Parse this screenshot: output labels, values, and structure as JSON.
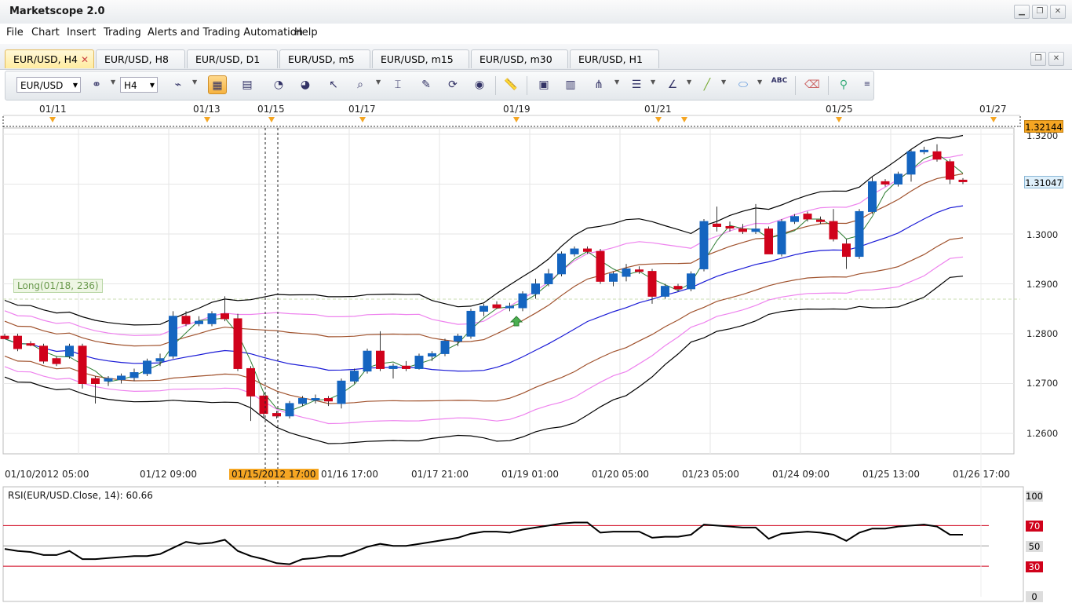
{
  "app": {
    "title": "Marketscope 2.0"
  },
  "window_controls": {
    "minimize": "▁",
    "restore": "❐",
    "close": "✕"
  },
  "menu": [
    "File",
    "Chart",
    "Insert",
    "Trading",
    "Alerts and Trading Automation",
    "Help"
  ],
  "tabs": [
    {
      "label": "EUR/USD, H4",
      "active": true,
      "close": "✕"
    },
    {
      "label": "EUR/USD, H8"
    },
    {
      "label": "EUR/USD, D1"
    },
    {
      "label": "EUR/USD, m5"
    },
    {
      "label": "EUR/USD, m15"
    },
    {
      "label": "EUR/USD, m30"
    },
    {
      "label": "EUR/USD, H1"
    }
  ],
  "toolbar": {
    "instrument": "EUR/USD",
    "timeframe": "H4",
    "icons": [
      "chart-type-icon",
      "candles-icon",
      "bars-icon",
      "add-indicator-icon",
      "remove-indicator-icon",
      "cursor-icon",
      "zoom-icon",
      "crosshair-icon",
      "edit-icon",
      "refresh-icon",
      "globe-icon",
      "ruler-icon",
      "screenshot-icon",
      "template-icon",
      "fibonacci-icon",
      "levels-icon",
      "trend-icon",
      "line-icon",
      "ellipse-icon",
      "text-icon",
      "eraser-icon",
      "tree-icon",
      "more-icon"
    ],
    "text_icon_label": "ABC"
  },
  "top_dates": [
    "01/11",
    "01/13",
    "01/15",
    "01/17",
    "01/19",
    "01/21",
    "01/25",
    "01/27"
  ],
  "x_labels": [
    "01/10/2012 05:00",
    "01/12 09:00",
    "01/15/2012 17:00",
    "01/16 17:00",
    "01/17 21:00",
    "01/19 01:00",
    "01/20 05:00",
    "01/23 05:00",
    "01/24 09:00",
    "01/25 13:00",
    "01/26 17:00"
  ],
  "price_labels": [
    "1.3200",
    "1.3000",
    "1.2900",
    "1.2800",
    "1.2700",
    "1.2600"
  ],
  "price_tags": {
    "high": "1.32144",
    "current": "1.31047"
  },
  "long_label": "Long(01/18, 236)",
  "rsi": {
    "title": "RSI(EUR/USD.Close, 14): 60.66",
    "levels": [
      "100",
      "70",
      "50",
      "30",
      "0"
    ]
  },
  "colors": {
    "bull": "#1565c0",
    "bear": "#d0021b",
    "accent": "#f5a623",
    "band_outer": "#000000",
    "band_pink": "#ee82ee",
    "band_brown": "#a0522d",
    "mid": "#1a1ad6"
  },
  "chart_data": {
    "type": "candlestick",
    "ylim": [
      1.254,
      1.323
    ],
    "candles": [
      {
        "o": 1.2795,
        "h": 1.28,
        "l": 1.279,
        "c": 1.279
      },
      {
        "o": 1.2795,
        "h": 1.28,
        "l": 1.2765,
        "c": 1.277
      },
      {
        "o": 1.278,
        "h": 1.2785,
        "l": 1.2775,
        "c": 1.2778
      },
      {
        "o": 1.2775,
        "h": 1.278,
        "l": 1.274,
        "c": 1.2745
      },
      {
        "o": 1.275,
        "h": 1.2755,
        "l": 1.2735,
        "c": 1.274
      },
      {
        "o": 1.2755,
        "h": 1.278,
        "l": 1.275,
        "c": 1.2775
      },
      {
        "o": 1.2775,
        "h": 1.278,
        "l": 1.269,
        "c": 1.27
      },
      {
        "o": 1.271,
        "h": 1.2715,
        "l": 1.266,
        "c": 1.27
      },
      {
        "o": 1.2705,
        "h": 1.2715,
        "l": 1.2695,
        "c": 1.271
      },
      {
        "o": 1.2708,
        "h": 1.272,
        "l": 1.27,
        "c": 1.2715
      },
      {
        "o": 1.2712,
        "h": 1.273,
        "l": 1.2705,
        "c": 1.2722
      },
      {
        "o": 1.272,
        "h": 1.275,
        "l": 1.2715,
        "c": 1.2745
      },
      {
        "o": 1.2745,
        "h": 1.276,
        "l": 1.2735,
        "c": 1.275
      },
      {
        "o": 1.2755,
        "h": 1.2845,
        "l": 1.275,
        "c": 1.2835
      },
      {
        "o": 1.2835,
        "h": 1.2845,
        "l": 1.2815,
        "c": 1.282
      },
      {
        "o": 1.282,
        "h": 1.2835,
        "l": 1.2815,
        "c": 1.2825
      },
      {
        "o": 1.282,
        "h": 1.2845,
        "l": 1.2815,
        "c": 1.284
      },
      {
        "o": 1.284,
        "h": 1.2875,
        "l": 1.2825,
        "c": 1.283
      },
      {
        "o": 1.283,
        "h": 1.284,
        "l": 1.2725,
        "c": 1.273
      },
      {
        "o": 1.273,
        "h": 1.2735,
        "l": 1.2625,
        "c": 1.2675
      },
      {
        "o": 1.2675,
        "h": 1.268,
        "l": 1.263,
        "c": 1.264
      },
      {
        "o": 1.264,
        "h": 1.2645,
        "l": 1.263,
        "c": 1.2635
      },
      {
        "o": 1.2635,
        "h": 1.2665,
        "l": 1.263,
        "c": 1.266
      },
      {
        "o": 1.266,
        "h": 1.2675,
        "l": 1.2655,
        "c": 1.267
      },
      {
        "o": 1.2668,
        "h": 1.2678,
        "l": 1.266,
        "c": 1.267
      },
      {
        "o": 1.267,
        "h": 1.2675,
        "l": 1.2655,
        "c": 1.2665
      },
      {
        "o": 1.266,
        "h": 1.271,
        "l": 1.265,
        "c": 1.2705
      },
      {
        "o": 1.2705,
        "h": 1.273,
        "l": 1.27,
        "c": 1.2725
      },
      {
        "o": 1.2725,
        "h": 1.277,
        "l": 1.272,
        "c": 1.2765
      },
      {
        "o": 1.2765,
        "h": 1.2805,
        "l": 1.2725,
        "c": 1.273
      },
      {
        "o": 1.273,
        "h": 1.274,
        "l": 1.271,
        "c": 1.2735
      },
      {
        "o": 1.2735,
        "h": 1.2745,
        "l": 1.2725,
        "c": 1.273
      },
      {
        "o": 1.273,
        "h": 1.276,
        "l": 1.2728,
        "c": 1.2755
      },
      {
        "o": 1.2755,
        "h": 1.2765,
        "l": 1.2745,
        "c": 1.276
      },
      {
        "o": 1.276,
        "h": 1.279,
        "l": 1.2755,
        "c": 1.2785
      },
      {
        "o": 1.2785,
        "h": 1.28,
        "l": 1.2775,
        "c": 1.2795
      },
      {
        "o": 1.2795,
        "h": 1.285,
        "l": 1.279,
        "c": 1.2845
      },
      {
        "o": 1.2845,
        "h": 1.286,
        "l": 1.2835,
        "c": 1.2855
      },
      {
        "o": 1.2858,
        "h": 1.2865,
        "l": 1.285,
        "c": 1.2852
      },
      {
        "o": 1.2852,
        "h": 1.2862,
        "l": 1.2845,
        "c": 1.2855
      },
      {
        "o": 1.2852,
        "h": 1.2885,
        "l": 1.2845,
        "c": 1.288
      },
      {
        "o": 1.288,
        "h": 1.291,
        "l": 1.287,
        "c": 1.29
      },
      {
        "o": 1.29,
        "h": 1.293,
        "l": 1.2895,
        "c": 1.292
      },
      {
        "o": 1.292,
        "h": 1.2965,
        "l": 1.2915,
        "c": 1.296
      },
      {
        "o": 1.296,
        "h": 1.2975,
        "l": 1.2955,
        "c": 1.297
      },
      {
        "o": 1.297,
        "h": 1.2975,
        "l": 1.296,
        "c": 1.2965
      },
      {
        "o": 1.2965,
        "h": 1.297,
        "l": 1.29,
        "c": 1.2905
      },
      {
        "o": 1.2905,
        "h": 1.2925,
        "l": 1.2895,
        "c": 1.292
      },
      {
        "o": 1.2915,
        "h": 1.294,
        "l": 1.2905,
        "c": 1.293
      },
      {
        "o": 1.2928,
        "h": 1.2935,
        "l": 1.292,
        "c": 1.2925
      },
      {
        "o": 1.2925,
        "h": 1.293,
        "l": 1.286,
        "c": 1.2875
      },
      {
        "o": 1.2875,
        "h": 1.29,
        "l": 1.287,
        "c": 1.2895
      },
      {
        "o": 1.2895,
        "h": 1.29,
        "l": 1.2885,
        "c": 1.289
      },
      {
        "o": 1.289,
        "h": 1.2925,
        "l": 1.2885,
        "c": 1.292
      },
      {
        "o": 1.293,
        "h": 1.303,
        "l": 1.2925,
        "c": 1.3025
      },
      {
        "o": 1.302,
        "h": 1.3055,
        "l": 1.3005,
        "c": 1.3015
      },
      {
        "o": 1.3015,
        "h": 1.3025,
        "l": 1.3005,
        "c": 1.3012
      },
      {
        "o": 1.301,
        "h": 1.302,
        "l": 1.3,
        "c": 1.3005
      },
      {
        "o": 1.3005,
        "h": 1.306,
        "l": 1.3,
        "c": 1.301
      },
      {
        "o": 1.301,
        "h": 1.3015,
        "l": 1.296,
        "c": 1.296
      },
      {
        "o": 1.296,
        "h": 1.303,
        "l": 1.2955,
        "c": 1.3025
      },
      {
        "o": 1.3025,
        "h": 1.304,
        "l": 1.302,
        "c": 1.3035
      },
      {
        "o": 1.304,
        "h": 1.3045,
        "l": 1.3025,
        "c": 1.303
      },
      {
        "o": 1.3028,
        "h": 1.3035,
        "l": 1.302,
        "c": 1.3025
      },
      {
        "o": 1.3025,
        "h": 1.305,
        "l": 1.2985,
        "c": 1.299
      },
      {
        "o": 1.298,
        "h": 1.299,
        "l": 1.293,
        "c": 1.2955
      },
      {
        "o": 1.2955,
        "h": 1.305,
        "l": 1.295,
        "c": 1.3045
      },
      {
        "o": 1.3045,
        "h": 1.3115,
        "l": 1.304,
        "c": 1.3105
      },
      {
        "o": 1.3105,
        "h": 1.311,
        "l": 1.3095,
        "c": 1.31
      },
      {
        "o": 1.31,
        "h": 1.3125,
        "l": 1.3095,
        "c": 1.312
      },
      {
        "o": 1.312,
        "h": 1.317,
        "l": 1.3105,
        "c": 1.3165
      },
      {
        "o": 1.3165,
        "h": 1.3175,
        "l": 1.316,
        "c": 1.3168
      },
      {
        "o": 1.3165,
        "h": 1.318,
        "l": 1.3145,
        "c": 1.315
      },
      {
        "o": 1.3145,
        "h": 1.315,
        "l": 1.31,
        "c": 1.311
      },
      {
        "o": 1.3108,
        "h": 1.3112,
        "l": 1.31,
        "c": 1.3105
      }
    ],
    "rsi_values": [
      47,
      45,
      44,
      41,
      41,
      45,
      37,
      37,
      38,
      39,
      40,
      40,
      42,
      48,
      54,
      52,
      53,
      56,
      45,
      40,
      37,
      33,
      32,
      37,
      38,
      40,
      40,
      44,
      49,
      52,
      50,
      50,
      52,
      54,
      56,
      58,
      62,
      64,
      64,
      63,
      66,
      68,
      70,
      72,
      73,
      73,
      63,
      64,
      64,
      64,
      58,
      59,
      59,
      61,
      71,
      70,
      69,
      68,
      68,
      57,
      62,
      63,
      64,
      63,
      61,
      55,
      63,
      67,
      67,
      69,
      70,
      71,
      69,
      61,
      61
    ],
    "rsi_ylim": [
      0,
      100
    ],
    "rsi_levels": [
      30,
      50,
      70
    ]
  }
}
